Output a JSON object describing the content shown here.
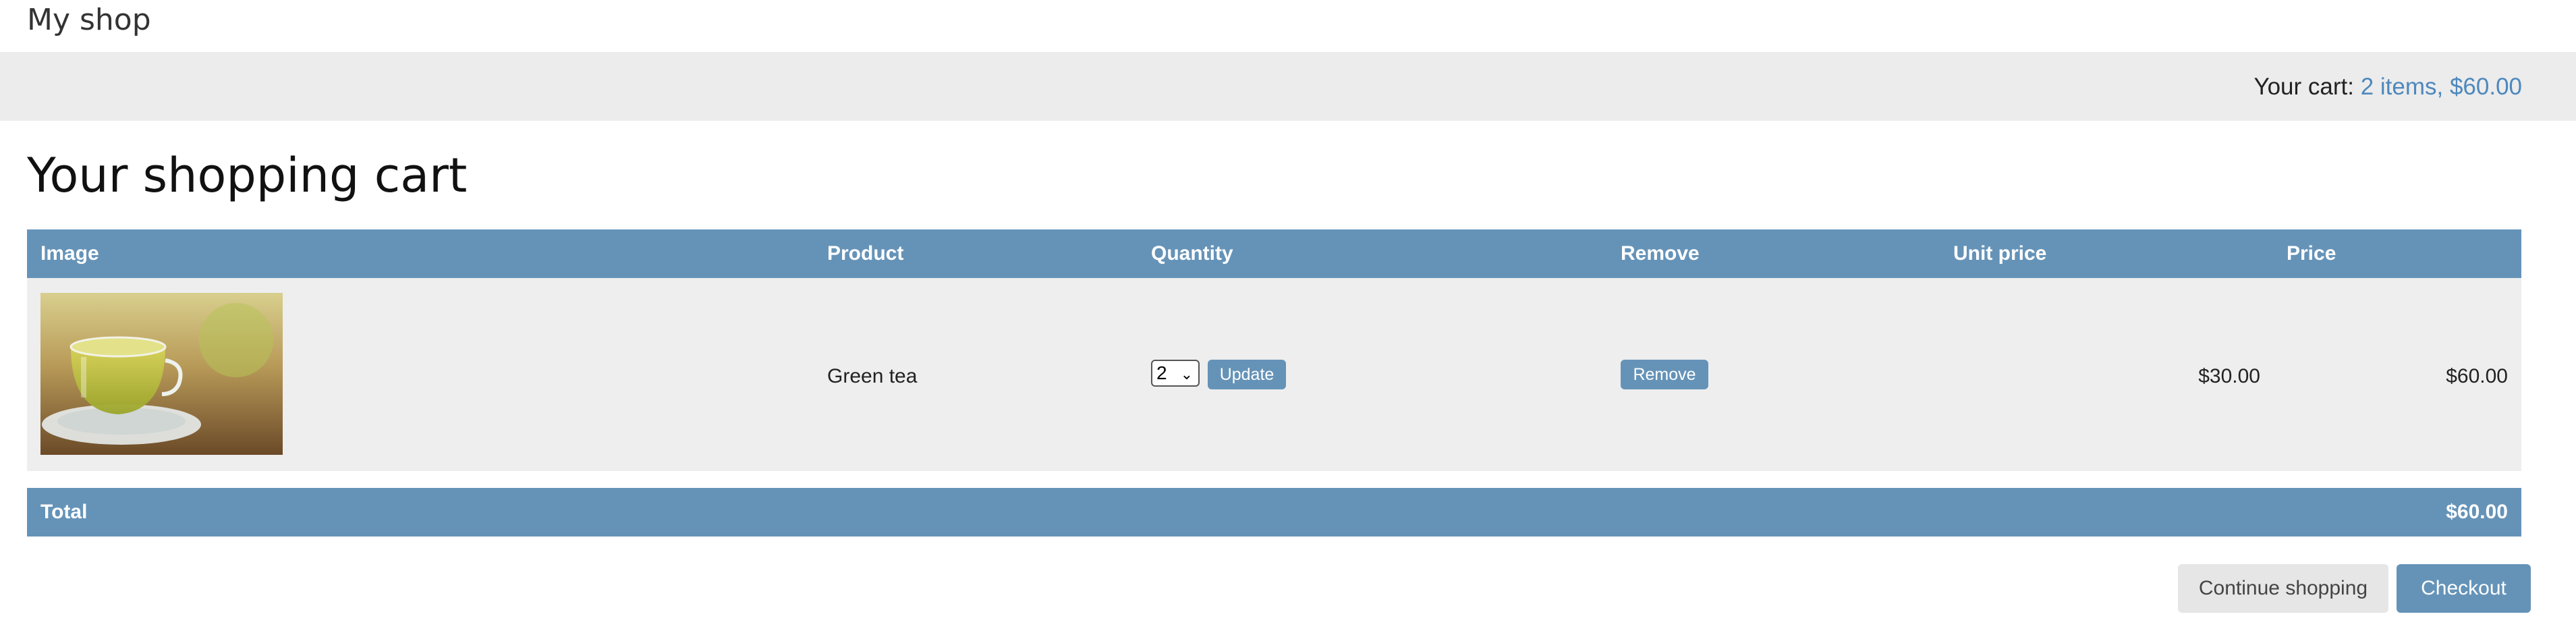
{
  "header": {
    "title": "My shop"
  },
  "cart_bar": {
    "label": "Your cart:",
    "summary_link": "2 items, $60.00"
  },
  "page_heading": "Your shopping cart",
  "table": {
    "columns": [
      "Image",
      "Product",
      "Quantity",
      "Remove",
      "Unit price",
      "Price"
    ],
    "rows": [
      {
        "image_alt": "green tea cup photo",
        "product": "Green tea",
        "quantity": "2",
        "update_label": "Update",
        "remove_label": "Remove",
        "unit_price": "$30.00",
        "price": "$60.00"
      }
    ],
    "total_label": "Total",
    "total_value": "$60.00"
  },
  "actions": {
    "continue_label": "Continue shopping",
    "checkout_label": "Checkout"
  },
  "colors": {
    "accent": "#6593b8",
    "link": "#4d88bd",
    "bar_bg": "#ececec",
    "row_bg": "#eeeeee"
  }
}
